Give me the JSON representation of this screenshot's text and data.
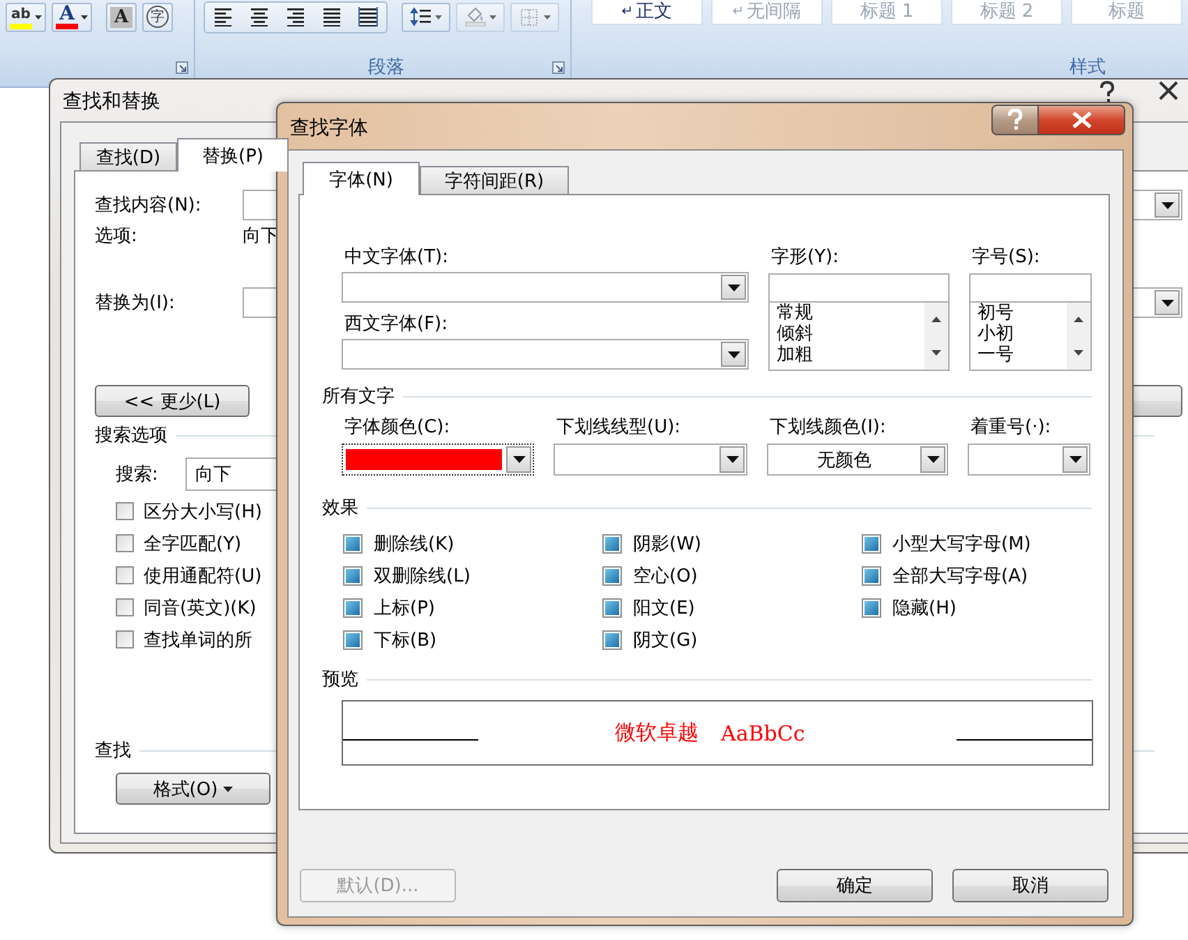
{
  "ribbon": {
    "font_tools": [
      {
        "kind": "highlight",
        "glyph": "ab",
        "color": "#ffff00"
      },
      {
        "kind": "font-color",
        "glyph": "A",
        "color": "#ff0000"
      },
      {
        "kind": "shading",
        "glyph": "A"
      },
      {
        "kind": "enclose",
        "glyph": "字"
      }
    ],
    "paragraph_tools": [
      {
        "kind": "align-left"
      },
      {
        "kind": "align-center"
      },
      {
        "kind": "align-right"
      },
      {
        "kind": "justify"
      },
      {
        "kind": "distribute"
      },
      {
        "kind": "line-spacing"
      },
      {
        "kind": "shading"
      },
      {
        "kind": "borders"
      }
    ],
    "paragraph_label": "段落",
    "styles": [
      {
        "mark": "↵",
        "label": "正文",
        "selected": true
      },
      {
        "mark": "↵",
        "label": "无间隔",
        "selected": false
      },
      {
        "label": "标题 1",
        "selected": false
      },
      {
        "label": "标题 2",
        "selected": false
      },
      {
        "label": "标题",
        "selected": false
      }
    ],
    "styles_label": "样式"
  },
  "find_replace": {
    "title": "查找和替换",
    "tabs": [
      {
        "label": "查找(D)",
        "selected": false
      },
      {
        "label": "替换(P)",
        "selected": true
      }
    ],
    "find_label": "查找内容(N):",
    "options_label": "选项:",
    "options_value": "向下",
    "replace_label": "替换为(I):",
    "less_button": "<< 更少(L)",
    "search_options_heading": "搜索选项",
    "search_label": "搜索:",
    "search_value": "向下",
    "checkboxes": [
      {
        "label": "区分大小写(H)",
        "checked": false
      },
      {
        "label": "全字匹配(Y)",
        "checked": false
      },
      {
        "label": "使用通配符(U)",
        "checked": false
      },
      {
        "label": "同音(英文)(K)",
        "checked": false
      },
      {
        "label": "查找单词的所",
        "checked": false
      }
    ],
    "find_heading": "查找",
    "format_button": "格式(O)"
  },
  "font_dialog": {
    "title": "查找字体",
    "tabs": [
      {
        "label": "字体(N)",
        "selected": true
      },
      {
        "label": "字符间距(R)",
        "selected": false
      }
    ],
    "chinese_font_label": "中文字体(T):",
    "western_font_label": "西文字体(F):",
    "style_label": "字形(Y):",
    "style_options": [
      "常规",
      "倾斜",
      "加粗"
    ],
    "size_label": "字号(S):",
    "size_options": [
      "初号",
      "小初",
      "一号"
    ],
    "all_text_heading": "所有文字",
    "font_color_label": "字体颜色(C):",
    "font_color": {
      "color": "#ff0000"
    },
    "underline_style_label": "下划线线型(U):",
    "underline_color_label": "下划线颜色(I):",
    "underline_color_value": "无颜色",
    "emphasis_label": "着重号(·):",
    "effects_heading": "效果",
    "effects": [
      {
        "label": "删除线(K)",
        "mixed": true
      },
      {
        "label": "双删除线(L)",
        "mixed": true
      },
      {
        "label": "上标(P)",
        "mixed": true
      },
      {
        "label": "下标(B)",
        "mixed": true
      },
      {
        "label": "阴影(W)",
        "mixed": true
      },
      {
        "label": "空心(O)",
        "mixed": true
      },
      {
        "label": "阳文(E)",
        "mixed": true
      },
      {
        "label": "阴文(G)",
        "mixed": true
      },
      {
        "label": "小型大写字母(M)",
        "mixed": true
      },
      {
        "label": "全部大写字母(A)",
        "mixed": true
      },
      {
        "label": "隐藏(H)",
        "mixed": true
      }
    ],
    "preview_heading": "预览",
    "preview_text": "微软卓越",
    "preview_sample": "AaBbCc",
    "buttons": [
      {
        "label": "默认(D)...",
        "disabled": true
      },
      {
        "label": "确定",
        "disabled": false
      },
      {
        "label": "取消",
        "disabled": false
      }
    ]
  }
}
